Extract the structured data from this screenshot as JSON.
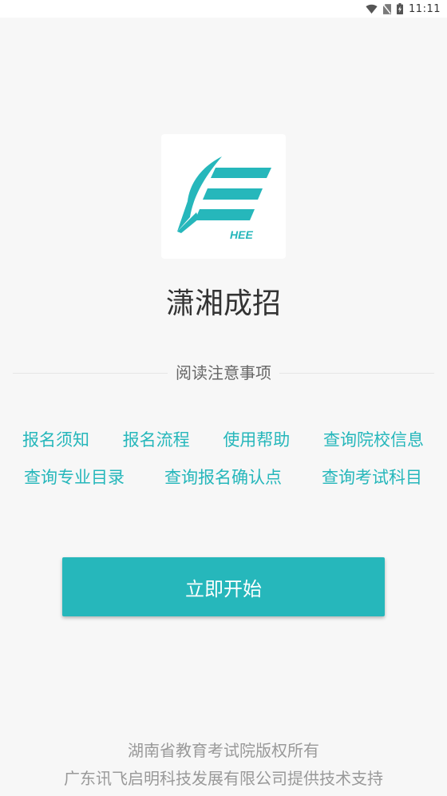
{
  "status_bar": {
    "time": "11:11",
    "icons": {
      "wifi": "wifi-icon",
      "sim": "no-sim-icon",
      "battery": "battery-charging-icon"
    }
  },
  "logo": {
    "text": "HEE"
  },
  "app": {
    "title": "潇湘成招"
  },
  "notice": {
    "heading": "阅读注意事项",
    "links_row_1": [
      {
        "label": "报名须知"
      },
      {
        "label": "报名流程"
      },
      {
        "label": "使用帮助"
      },
      {
        "label": "查询院校信息"
      }
    ],
    "links_row_2": [
      {
        "label": "查询专业目录"
      },
      {
        "label": "查询报名确认点"
      },
      {
        "label": "查询考试科目"
      }
    ]
  },
  "primary_button": {
    "label": "立即开始"
  },
  "footer": {
    "copyright": "湖南省教育考试院版权所有",
    "support": "广东讯飞启明科技发展有限公司提供技术支持"
  },
  "colors": {
    "accent": "#26b7bb",
    "background": "#f7f7f7",
    "title_text": "#333333",
    "muted_text": "#999999"
  }
}
